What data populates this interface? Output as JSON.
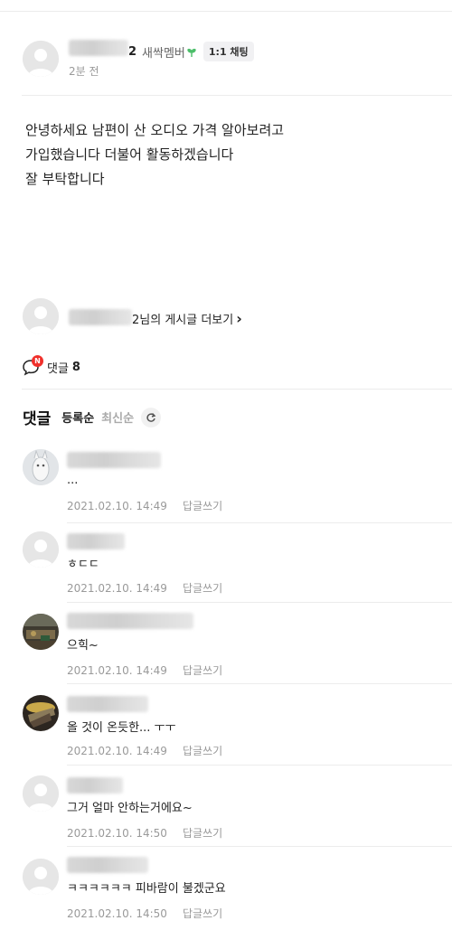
{
  "post": {
    "author_suffix": "2",
    "member_grade": "새싹멤버",
    "chat_button": "1:1 채팅",
    "time": "2분 전",
    "body_lines": [
      "안녕하세요 남편이 산 오디오 가격 알아보려고",
      "가입했습니다 더불어 활동하겠습니다",
      "잘 부탁합니다"
    ],
    "more_posts_suffix": "2님의 게시글 더보기",
    "more_chevron": "›"
  },
  "comment_bar": {
    "badge": "N",
    "label": "댓글",
    "count": "8"
  },
  "comments_section": {
    "title": "댓글",
    "sort_registered": "등록순",
    "sort_latest": "최신순",
    "refresh_icon": "refresh-icon"
  },
  "comments": [
    {
      "text": "...",
      "date": "2021.02.10. 14:49",
      "reply": "답글쓰기"
    },
    {
      "text": "ㅎㄷㄷ",
      "date": "2021.02.10. 14:49",
      "reply": "답글쓰기"
    },
    {
      "text": "으힉~",
      "date": "2021.02.10. 14:49",
      "reply": "답글쓰기"
    },
    {
      "text": "올 것이 온듯한... ㅜㅜ",
      "date": "2021.02.10. 14:49",
      "reply": "답글쓰기"
    },
    {
      "text": "그거 얼마 안하는거에요~",
      "date": "2021.02.10. 14:50",
      "reply": "답글쓰기"
    },
    {
      "text": "ㅋㅋㅋㅋㅋㅋ 피바람이 불겠군요",
      "date": "2021.02.10. 14:50",
      "reply": "답글쓰기"
    }
  ],
  "colors": {
    "grade_leaf": "#4cbe6a",
    "badge_red": "#f0302b",
    "divider": "#ececec"
  }
}
